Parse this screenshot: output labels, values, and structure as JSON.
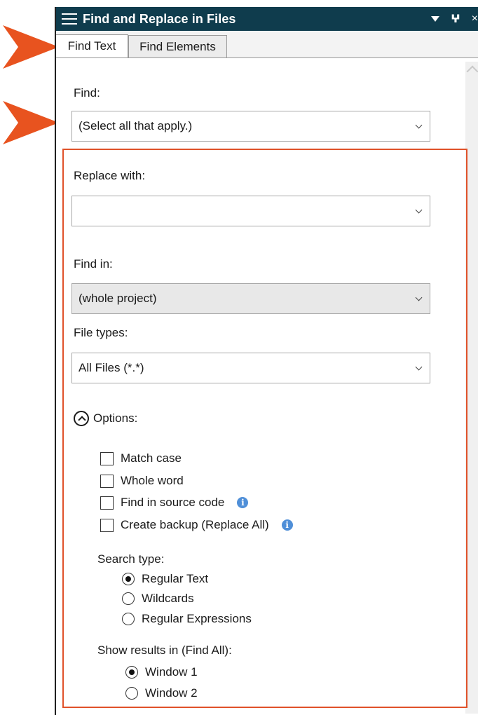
{
  "window": {
    "title": "Find and Replace in Files",
    "close_glyph": "×",
    "pin_glyph": "⨅"
  },
  "tabs": [
    {
      "label": "Find Text",
      "active": true
    },
    {
      "label": "Find Elements",
      "active": false
    }
  ],
  "find": {
    "label": "Find:",
    "value": "(Select all that apply.)"
  },
  "replace": {
    "label": "Replace with:",
    "value": ""
  },
  "find_in": {
    "label": "Find in:",
    "value": "(whole project)"
  },
  "file_types": {
    "label": "File types:",
    "value": "All Files (*.*)"
  },
  "options": {
    "label": "Options:",
    "checkboxes": [
      {
        "label": "Match case",
        "checked": false
      },
      {
        "label": "Whole word",
        "checked": false
      },
      {
        "label": "Find in source code",
        "checked": false,
        "info": true
      },
      {
        "label": "Create backup (Replace All)",
        "checked": false,
        "info": true
      }
    ],
    "search_type": {
      "label": "Search type:",
      "choices": [
        {
          "label": "Regular Text",
          "selected": true
        },
        {
          "label": "Wildcards",
          "selected": false
        },
        {
          "label": "Regular Expressions",
          "selected": false
        }
      ]
    },
    "show_results": {
      "label": "Show results in (Find All):",
      "choices": [
        {
          "label": "Window 1",
          "selected": true
        },
        {
          "label": "Window 2",
          "selected": false
        }
      ]
    }
  },
  "colors": {
    "titlebar": "#0f3c4d",
    "callout_arrow": "#e8531f",
    "highlight_border": "#e0522a",
    "info_icon": "#4f8fd8"
  }
}
